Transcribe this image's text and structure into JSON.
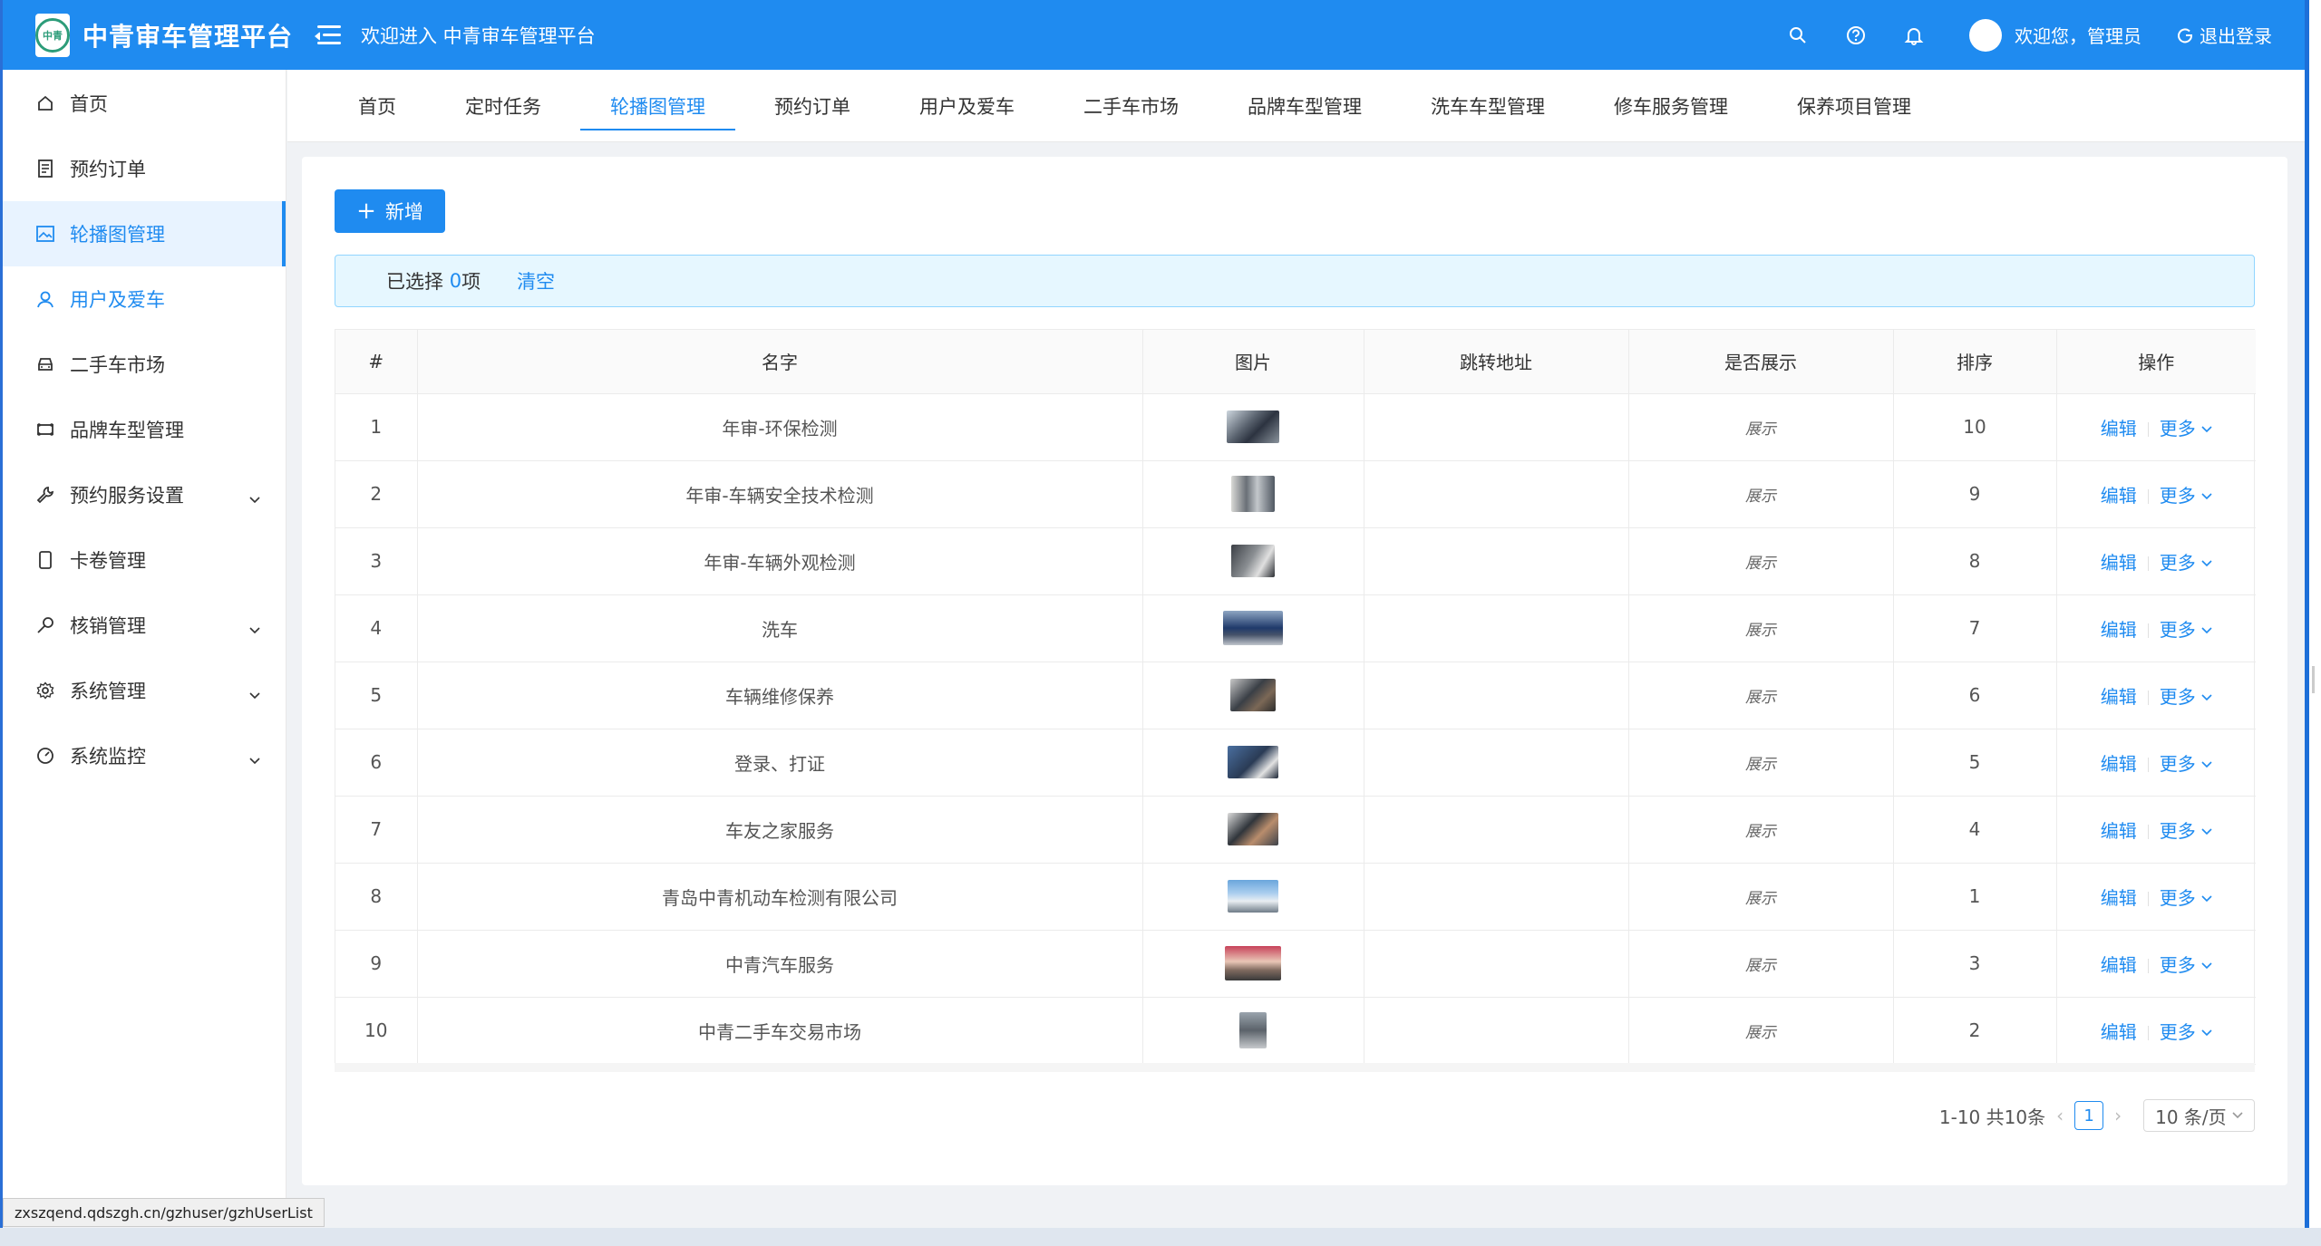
{
  "app": {
    "logo_text": "中青",
    "brand": "中青审车管理平台",
    "welcome": "欢迎进入 中青审车管理平台",
    "user_greeting": "欢迎您，管理员",
    "logout": "退出登录"
  },
  "sidebar": {
    "items": [
      {
        "label": "首页",
        "icon": "home-icon"
      },
      {
        "label": "预约订单",
        "icon": "file-text-icon"
      },
      {
        "label": "轮播图管理",
        "icon": "image-icon"
      },
      {
        "label": "用户及爱车",
        "icon": "user-icon"
      },
      {
        "label": "二手车市场",
        "icon": "car-icon"
      },
      {
        "label": "品牌车型管理",
        "icon": "truck-icon"
      },
      {
        "label": "预约服务设置",
        "icon": "tool-icon"
      },
      {
        "label": "卡卷管理",
        "icon": "mobile-icon"
      },
      {
        "label": "核销管理",
        "icon": "key-icon"
      },
      {
        "label": "系统管理",
        "icon": "gear-icon"
      },
      {
        "label": "系统监控",
        "icon": "dashboard-icon"
      }
    ]
  },
  "tabs": [
    "首页",
    "定时任务",
    "轮播图管理",
    "预约订单",
    "用户及爱车",
    "二手车市场",
    "品牌车型管理",
    "洗车车型管理",
    "修车服务管理",
    "保养项目管理"
  ],
  "toolbar": {
    "add_label": "新增"
  },
  "selection": {
    "prefix": "已选择",
    "count": "0",
    "suffix": "项",
    "clear": "清空"
  },
  "table": {
    "columns": [
      "#",
      "名字",
      "图片",
      "跳转地址",
      "是否展示",
      "排序",
      "操作"
    ],
    "edit_label": "编辑",
    "more_label": "更多",
    "rows": [
      {
        "index": "1",
        "name": "年审-环保检测",
        "link": "",
        "show": "展示",
        "sort": "10"
      },
      {
        "index": "2",
        "name": "年审-车辆安全技术检测",
        "link": "",
        "show": "展示",
        "sort": "9"
      },
      {
        "index": "3",
        "name": "年审-车辆外观检测",
        "link": "",
        "show": "展示",
        "sort": "8"
      },
      {
        "index": "4",
        "name": "洗车",
        "link": "",
        "show": "展示",
        "sort": "7"
      },
      {
        "index": "5",
        "name": "车辆维修保养",
        "link": "",
        "show": "展示",
        "sort": "6"
      },
      {
        "index": "6",
        "name": "登录、打证",
        "link": "",
        "show": "展示",
        "sort": "5"
      },
      {
        "index": "7",
        "name": "车友之家服务",
        "link": "",
        "show": "展示",
        "sort": "4"
      },
      {
        "index": "8",
        "name": "青岛中青机动车检测有限公司",
        "link": "",
        "show": "展示",
        "sort": "1"
      },
      {
        "index": "9",
        "name": "中青汽车服务",
        "link": "",
        "show": "展示",
        "sort": "3"
      },
      {
        "index": "10",
        "name": "中青二手车交易市场",
        "link": "",
        "show": "展示",
        "sort": "2"
      }
    ]
  },
  "pagination": {
    "range": "1-10 共10条",
    "current": "1",
    "page_size": "10 条/页"
  },
  "status_url": "zxszqend.qdszgh.cn/gzhuser/gzhUserList",
  "colors": {
    "primary": "#1f8bf0",
    "header": "#1f8bf0",
    "selection_bg": "#e6f7ff"
  }
}
